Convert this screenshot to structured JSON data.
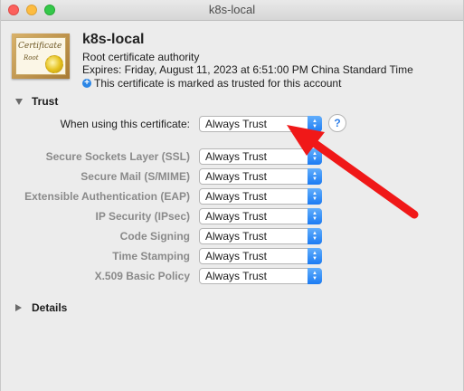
{
  "window": {
    "title": "k8s-local"
  },
  "certificate": {
    "icon_word": "Certificate",
    "icon_root": "Root",
    "name": "k8s-local",
    "type": "Root certificate authority",
    "expires": "Expires: Friday, August 11, 2023 at 6:51:00 PM China Standard Time",
    "trusted_note": "This certificate is marked as trusted for this account"
  },
  "trust": {
    "section_label": "Trust",
    "when_using": {
      "label": "When using this certificate:",
      "value": "Always Trust"
    },
    "rows": [
      {
        "label": "Secure Sockets Layer (SSL)",
        "value": "Always Trust"
      },
      {
        "label": "Secure Mail (S/MIME)",
        "value": "Always Trust"
      },
      {
        "label": "Extensible Authentication (EAP)",
        "value": "Always Trust"
      },
      {
        "label": "IP Security (IPsec)",
        "value": "Always Trust"
      },
      {
        "label": "Code Signing",
        "value": "Always Trust"
      },
      {
        "label": "Time Stamping",
        "value": "Always Trust"
      },
      {
        "label": "X.509 Basic Policy",
        "value": "Always Trust"
      }
    ],
    "help_glyph": "?"
  },
  "details": {
    "section_label": "Details"
  },
  "colors": {
    "annotation_arrow": "#f01818",
    "select_accent": "#1b7bf3"
  }
}
